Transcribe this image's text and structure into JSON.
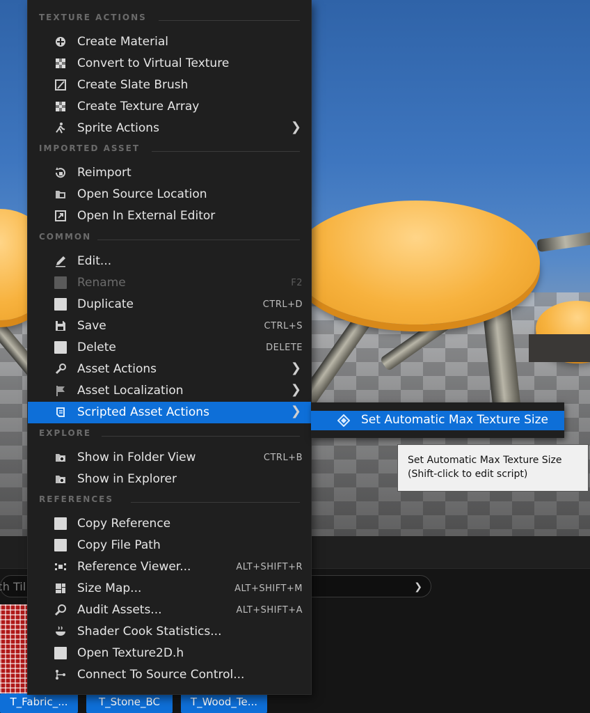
{
  "menu": {
    "sections": {
      "texture_actions": "TEXTURE ACTIONS",
      "imported_asset": "IMPORTED ASSET",
      "common": "COMMON",
      "explore": "EXPLORE",
      "references": "REFERENCES"
    },
    "texture_actions": [
      {
        "label": "Create Material",
        "icon": "material-sphere-icon"
      },
      {
        "label": "Convert to Virtual Texture",
        "icon": "checker-icon"
      },
      {
        "label": "Create Slate Brush",
        "icon": "slate-brush-icon"
      },
      {
        "label": "Create Texture Array",
        "icon": "checker-icon"
      },
      {
        "label": "Sprite Actions",
        "icon": "sprite-icon",
        "submenu": true
      }
    ],
    "imported_asset": [
      {
        "label": "Reimport",
        "icon": "reimport-icon"
      },
      {
        "label": "Open Source Location",
        "icon": "folder-icon"
      },
      {
        "label": "Open In External Editor",
        "icon": "external-editor-icon"
      }
    ],
    "common": [
      {
        "label": "Edit...",
        "icon": "edit-pencil-icon"
      },
      {
        "label": "Rename",
        "icon": "rename-icon",
        "shortcut": "F2",
        "disabled": true
      },
      {
        "label": "Duplicate",
        "icon": "duplicate-icon",
        "shortcut": "CTRL+D"
      },
      {
        "label": "Save",
        "icon": "save-icon",
        "shortcut": "CTRL+S"
      },
      {
        "label": "Delete",
        "icon": "delete-icon",
        "shortcut": "DELETE"
      },
      {
        "label": "Asset Actions",
        "icon": "wrench-icon",
        "submenu": true
      },
      {
        "label": "Asset Localization",
        "icon": "flag-icon",
        "submenu": true
      },
      {
        "label": "Scripted Asset Actions",
        "icon": "script-icon",
        "submenu": true,
        "active": true
      }
    ],
    "explore": [
      {
        "label": "Show in Folder View",
        "icon": "folder-search-icon",
        "shortcut": "CTRL+B"
      },
      {
        "label": "Show in Explorer",
        "icon": "folder-search-icon"
      }
    ],
    "references": [
      {
        "label": "Copy Reference",
        "icon": "copy-reference-icon"
      },
      {
        "label": "Copy File Path",
        "icon": "copy-path-icon"
      },
      {
        "label": "Reference Viewer...",
        "icon": "reference-viewer-icon",
        "shortcut": "ALT+SHIFT+R"
      },
      {
        "label": "Size Map...",
        "icon": "size-map-icon",
        "shortcut": "ALT+SHIFT+M"
      },
      {
        "label": "Audit Assets...",
        "icon": "audit-icon",
        "shortcut": "ALT+SHIFT+A"
      },
      {
        "label": "Shader Cook Statistics...",
        "icon": "shader-cook-icon"
      },
      {
        "label": "Open Texture2D.h",
        "icon": "open-header-icon"
      },
      {
        "label": "Connect To Source Control...",
        "icon": "source-control-icon"
      }
    ]
  },
  "submenu": {
    "item": {
      "label": "Set Automatic Max Texture Size",
      "icon": "script-diamond-icon"
    }
  },
  "tooltip": {
    "line1": "Set Automatic Max Texture Size",
    "line2": "(Shift-click to edit script)"
  },
  "content_browser": {
    "search_placeholder": "ch Til",
    "tiles": [
      {
        "label": "T_Fabric_..."
      },
      {
        "label": "T_Stone_BC"
      },
      {
        "label": "T_Wood_Te..."
      }
    ]
  },
  "colors": {
    "accent": "#0e6fd8",
    "menu_bg": "#1f1f1f",
    "text": "#e6e6e6",
    "section": "#6a6a6a"
  }
}
